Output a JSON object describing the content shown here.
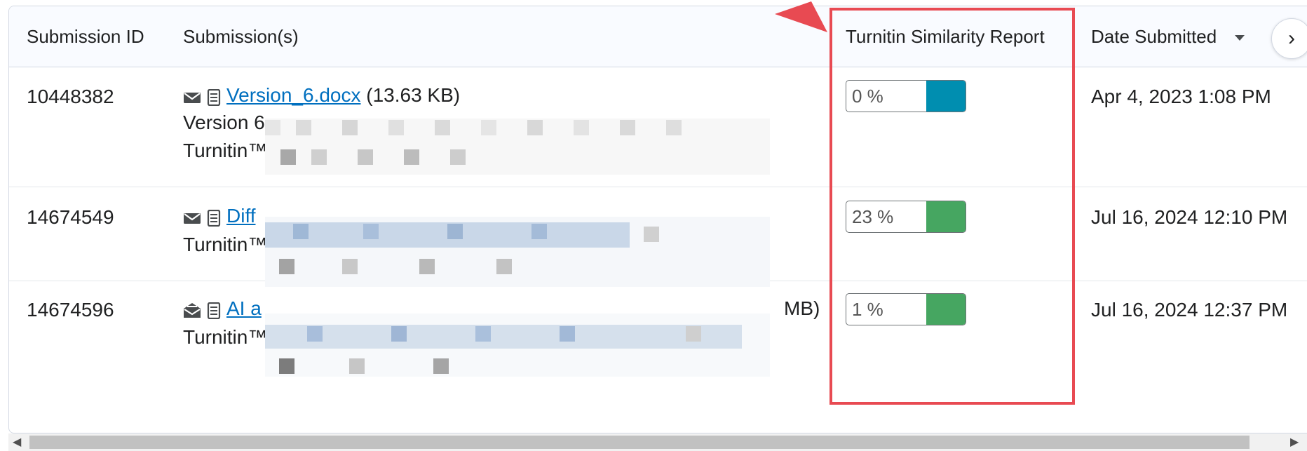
{
  "table": {
    "headers": {
      "submission_id": "Submission ID",
      "submissions": "Submission(s)",
      "turnitin": "Turnitin Similarity Report",
      "date_submitted": "Date Submitted"
    },
    "rows": [
      {
        "id": "10448382",
        "file_link": "Version_6.docx",
        "file_size": "(13.63 KB)",
        "line2": "Version 6",
        "line3": "Turnitin™",
        "score": "0 %",
        "score_color": "#008eb0",
        "date": "Apr 4, 2023 1:08 PM"
      },
      {
        "id": "14674549",
        "file_link": "Diff",
        "file_size": "",
        "line2": "Turnitin™",
        "line3": "",
        "score": "23 %",
        "score_color": "#46a661",
        "date": "Jul 16, 2024 12:10 PM"
      },
      {
        "id": "14674596",
        "file_link": "AI a",
        "file_size": "MB)",
        "line2": "Turnitin™",
        "line3": "",
        "score": "1 %",
        "score_color": "#46a661",
        "date": "Jul 16, 2024 12:37 PM"
      }
    ]
  },
  "icons": {
    "email": "envelope-icon",
    "email_open": "envelope-open-icon",
    "document": "document-icon",
    "sort": "sort-down-icon",
    "next": "chevron-right-icon"
  },
  "scroll": {
    "left_arrow": "◀",
    "right_arrow": "▶"
  },
  "next_glyph": "›",
  "colors": {
    "highlight": "#e84a52",
    "link": "#006fbf"
  }
}
